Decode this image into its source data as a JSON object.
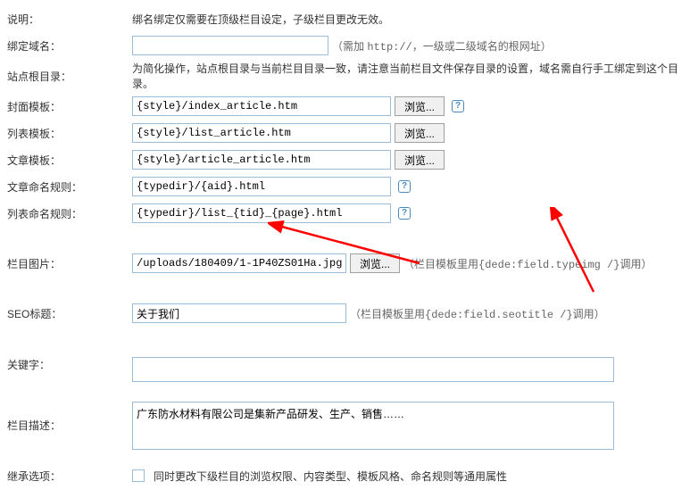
{
  "rows": {
    "explain": {
      "label": "说明：",
      "text": "绑名绑定仅需要在顶级栏目设定，子级栏目更改无效。"
    },
    "bind_domain": {
      "label": "绑定域名：",
      "value": "",
      "hint_pre": "（需加 ",
      "hint_code": "http://",
      "hint_post": "，一级或二级域名的根网址）"
    },
    "site_root": {
      "label": "站点根目录：",
      "text": "为简化操作，站点根目录与当前栏目目录一致，请注意当前栏目文件保存目录的设置，域名需自行手工绑定到这个目录。"
    },
    "cover_tpl": {
      "label": "封面模板：",
      "value": "{style}/index_article.htm",
      "btn": "浏览..."
    },
    "list_tpl": {
      "label": "列表模板：",
      "value": "{style}/list_article.htm",
      "btn": "浏览..."
    },
    "article_tpl": {
      "label": "文章模板：",
      "value": "{style}/article_article.htm",
      "btn": "浏览..."
    },
    "article_rule": {
      "label": "文章命名规则：",
      "value": "{typedir}/{aid}.html"
    },
    "list_rule": {
      "label": "列表命名规则：",
      "value": "{typedir}/list_{tid}_{page}.html"
    },
    "col_image": {
      "label": "栏目图片：",
      "value": "/uploads/180409/1-1P40ZS01Ha.jpg",
      "btn": "浏览...",
      "hint_pre": "（栏目模板里用",
      "hint_code": "{dede:field.typeimg /}",
      "hint_post": "调用）"
    },
    "seo_title": {
      "label": "SEO标题：",
      "value": "关于我们",
      "hint_pre": "（栏目模板里用",
      "hint_code": "{dede:field.seotitle /}",
      "hint_post": "调用）"
    },
    "keywords": {
      "label": "关键字：",
      "value": ""
    },
    "desc": {
      "label": "栏目描述：",
      "value": "广东防水材料有限公司是集新产品研发、生产、销售……"
    },
    "inherit": {
      "label": "继承选项：",
      "text": "同时更改下级栏目的浏览权限、内容类型、模板风格、命名规则等通用属性"
    }
  }
}
